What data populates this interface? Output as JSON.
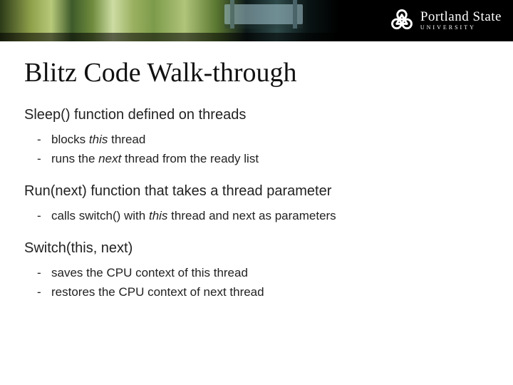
{
  "banner": {
    "logo": {
      "name": "Portland State",
      "subname": "UNIVERSITY",
      "icon": "psu-interlock-icon"
    }
  },
  "title": "Blitz Code Walk-through",
  "sections": [
    {
      "heading": "Sleep() function defined on threads",
      "bullets": [
        {
          "pre": "blocks ",
          "em": "this",
          "post": " thread"
        },
        {
          "pre": "runs the ",
          "em": "next",
          "post": " thread from the ready list"
        }
      ]
    },
    {
      "heading": "Run(next) function that takes a thread parameter",
      "bullets": [
        {
          "pre": "calls switch() with ",
          "em": "this",
          "post": " thread and next as parameters"
        }
      ]
    },
    {
      "heading": "Switch(this, next)",
      "bullets": [
        {
          "pre": "saves the CPU context of this thread",
          "em": "",
          "post": ""
        },
        {
          "pre": "restores the CPU context of next thread",
          "em": "",
          "post": ""
        }
      ]
    }
  ]
}
